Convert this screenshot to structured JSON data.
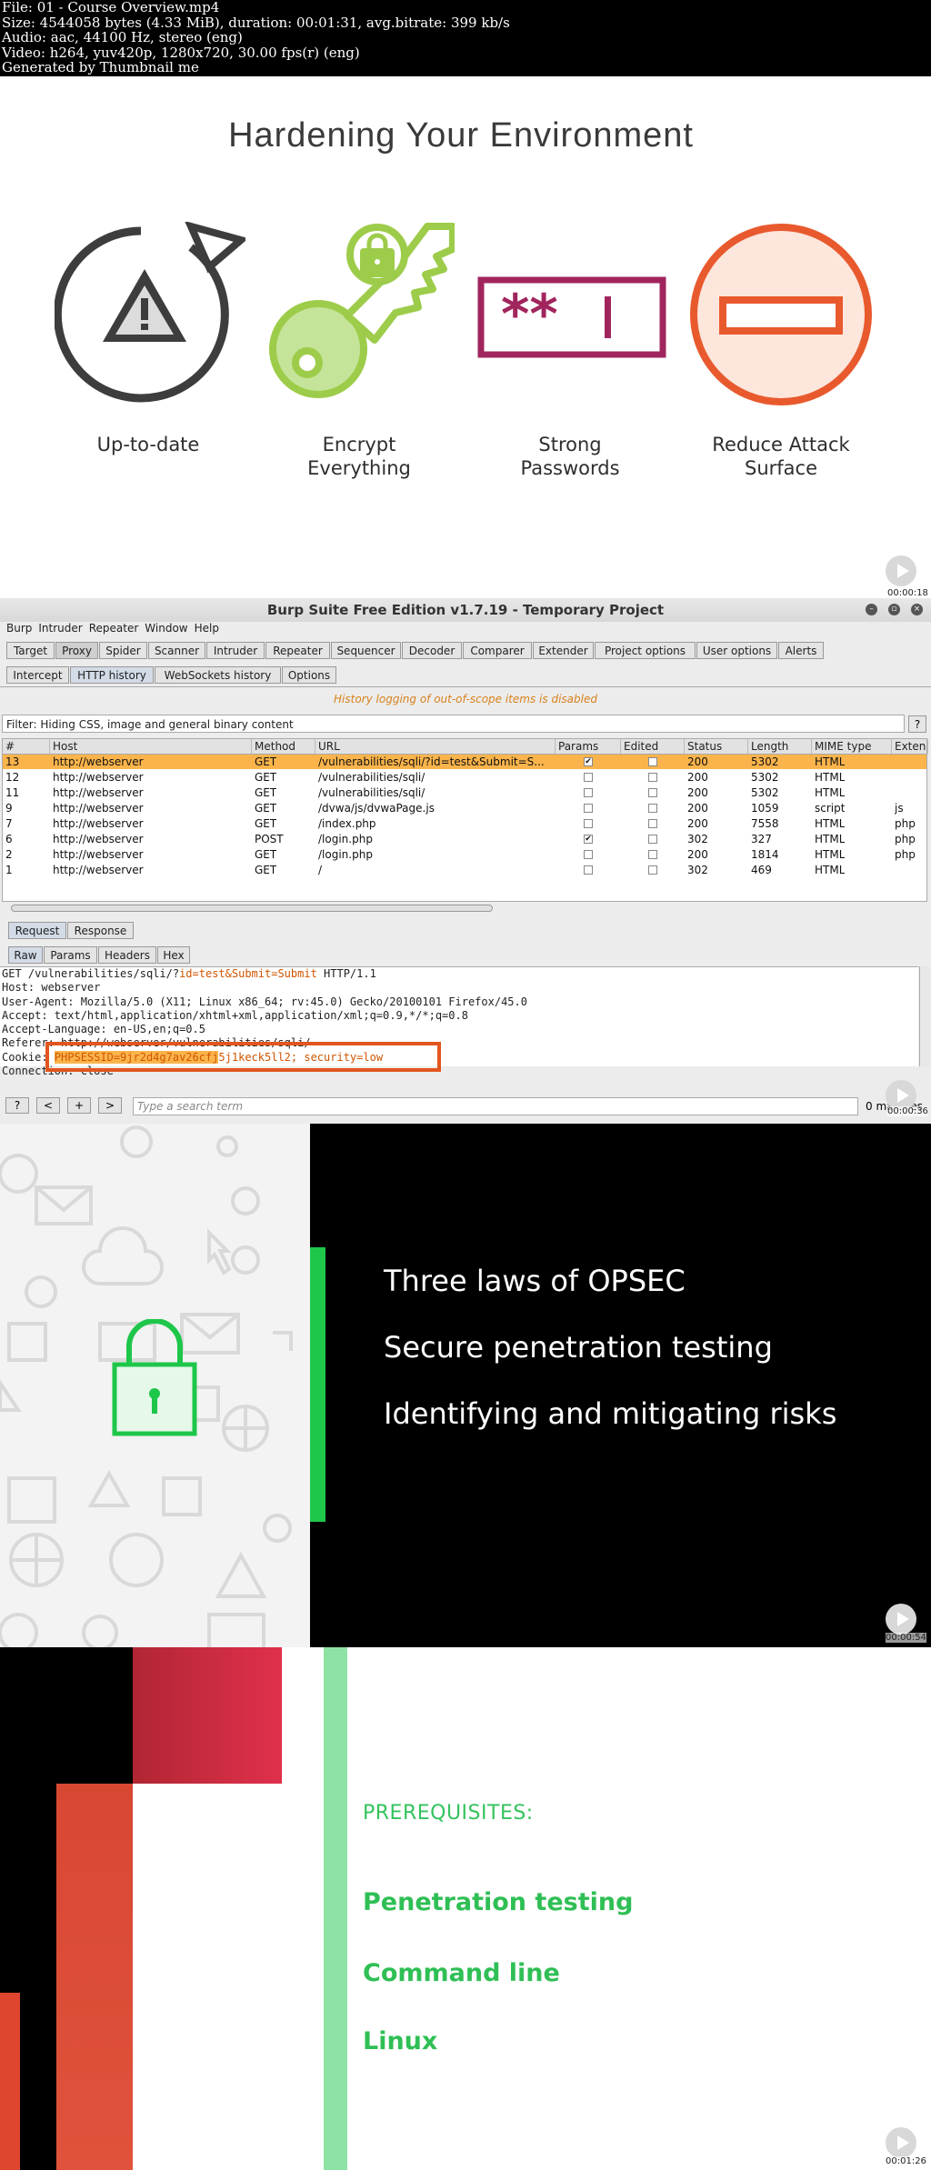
{
  "meta": {
    "line1": "File: 01 - Course Overview.mp4",
    "line2": "Size: 4544058 bytes (4.33 MiB), duration: 00:01:31, avg.bitrate: 399 kb/s",
    "line3": "Audio: aac, 44100 Hz, stereo (eng)",
    "line4": "Video: h264, yuv420p, 1280x720, 30.00 fps(r) (eng)",
    "line5": "Generated by Thumbnail me"
  },
  "frame1": {
    "title": "Hardening Your Environment",
    "items": [
      {
        "line1": "Up-to-date",
        "line2": ""
      },
      {
        "line1": "Encrypt",
        "line2": "Everything"
      },
      {
        "line1": "Strong",
        "line2": "Passwords"
      },
      {
        "line1": "Reduce Attack",
        "line2": "Surface"
      }
    ],
    "colors": {
      "dark": "#3d3d3d",
      "green": "#9dcc4a",
      "purple": "#a1255d",
      "orange": "#e85a2e",
      "peach": "#fde6dc"
    },
    "timestamp": "00:00:18"
  },
  "burp": {
    "title": "Burp Suite Free Edition v1.7.19 - Temporary Project",
    "menu": [
      "Burp",
      "Intruder",
      "Repeater",
      "Window",
      "Help"
    ],
    "main_tabs": [
      "Target",
      "Proxy",
      "Spider",
      "Scanner",
      "Intruder",
      "Repeater",
      "Sequencer",
      "Decoder",
      "Comparer",
      "Extender",
      "Project options",
      "User options",
      "Alerts"
    ],
    "proxy_tabs": [
      "Intercept",
      "HTTP history",
      "WebSockets history",
      "Options"
    ],
    "notice": "History logging of out-of-scope items is disabled",
    "filter": "Filter: Hiding CSS, image and general binary content",
    "filter_help": "?",
    "columns": [
      "#",
      "Host",
      "Method",
      "URL",
      "Params",
      "Edited",
      "Status",
      "Length",
      "MIME type",
      "Exten"
    ],
    "rows": [
      {
        "num": "13",
        "host": "http://webserver",
        "method": "GET",
        "url": "/vulnerabilities/sqli/?id=test&Submit=S...",
        "params": true,
        "edited": false,
        "status": "200",
        "length": "5302",
        "mime": "HTML",
        "ext": ""
      },
      {
        "num": "12",
        "host": "http://webserver",
        "method": "GET",
        "url": "/vulnerabilities/sqli/",
        "params": false,
        "edited": false,
        "status": "200",
        "length": "5302",
        "mime": "HTML",
        "ext": ""
      },
      {
        "num": "11",
        "host": "http://webserver",
        "method": "GET",
        "url": "/vulnerabilities/sqli/",
        "params": false,
        "edited": false,
        "status": "200",
        "length": "5302",
        "mime": "HTML",
        "ext": ""
      },
      {
        "num": "9",
        "host": "http://webserver",
        "method": "GET",
        "url": "/dvwa/js/dvwaPage.js",
        "params": false,
        "edited": false,
        "status": "200",
        "length": "1059",
        "mime": "script",
        "ext": "js"
      },
      {
        "num": "7",
        "host": "http://webserver",
        "method": "GET",
        "url": "/index.php",
        "params": false,
        "edited": false,
        "status": "200",
        "length": "7558",
        "mime": "HTML",
        "ext": "php"
      },
      {
        "num": "6",
        "host": "http://webserver",
        "method": "POST",
        "url": "/login.php",
        "params": true,
        "edited": false,
        "status": "302",
        "length": "327",
        "mime": "HTML",
        "ext": "php"
      },
      {
        "num": "2",
        "host": "http://webserver",
        "method": "GET",
        "url": "/login.php",
        "params": false,
        "edited": false,
        "status": "200",
        "length": "1814",
        "mime": "HTML",
        "ext": "php"
      },
      {
        "num": "1",
        "host": "http://webserver",
        "method": "GET",
        "url": "/",
        "params": false,
        "edited": false,
        "status": "302",
        "length": "469",
        "mime": "HTML",
        "ext": ""
      }
    ],
    "req_tabs": [
      "Request",
      "Response"
    ],
    "view_tabs": [
      "Raw",
      "Params",
      "Headers",
      "Hex"
    ],
    "request": {
      "l1a": "GET /vulnerabilities/sqli/?",
      "l1b": "id=test&Submit=Submit",
      "l1c": " HTTP/1.1",
      "l2": "Host: webserver",
      "l3": "User-Agent: Mozilla/5.0 (X11; Linux x86_64; rv:45.0) Gecko/20100101 Firefox/45.0",
      "l4": "Accept: text/html,application/xhtml+xml,application/xml;q=0.9,*/*;q=0.8",
      "l5": "Accept-Language: en-US,en;q=0.5",
      "l6": "Referer: http://webserver/vulnerabilities/sqli/",
      "l7a": "Cookie: ",
      "l7b": "PHPSESSID=9jr2d4g7av26cfj",
      "l7c": "5j1keck5ll2; security=low",
      "l8": "Connection: close"
    },
    "search": {
      "btn_help": "?",
      "btn_prev": "<",
      "btn_add": "+",
      "btn_next": ">",
      "placeholder": "Type a search term",
      "matches": "0 matches"
    },
    "timestamp": "00:00:36"
  },
  "frame3": {
    "items": [
      "Three laws of OPSEC",
      "Secure penetration testing",
      "Identifying and mitigating risks"
    ],
    "timestamp": "00:00:54"
  },
  "frame4": {
    "heading": "PREREQUISITES:",
    "items": [
      "Penetration testing",
      "Command line",
      "Linux"
    ],
    "timestamp": "00:01:26"
  }
}
